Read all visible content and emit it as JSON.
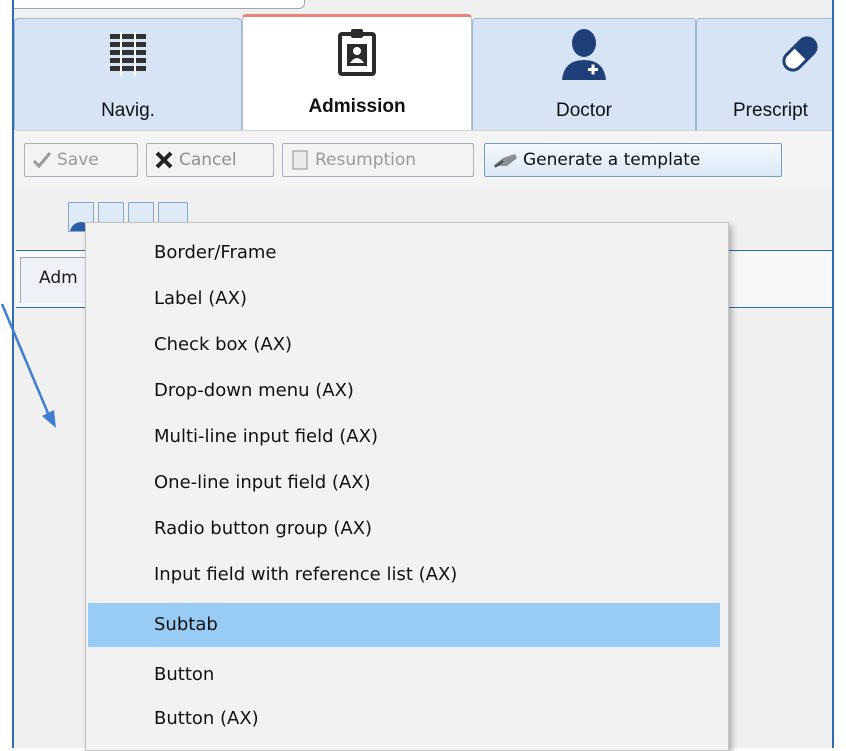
{
  "module_tabs": [
    {
      "label": "Navig.",
      "icon": "list-icon"
    },
    {
      "label": "Admission",
      "icon": "clipboard-id-icon",
      "active": true
    },
    {
      "label": "Doctor",
      "icon": "doctor-icon"
    },
    {
      "label": "Prescript",
      "icon": "pill-icon"
    }
  ],
  "toolbar": {
    "save_label": "Save",
    "cancel_label": "Cancel",
    "resumption_label": "Resumption",
    "generate_label": "Generate a template"
  },
  "content_tab": {
    "label": "Adm"
  },
  "context_menu": {
    "items": [
      "Border/Frame",
      "Label (AX)",
      "Check box (AX)",
      "Drop-down menu (AX)",
      "Multi-line input field (AX)",
      "One-line input field (AX)",
      "Radio button group (AX)",
      "Input field with reference list (AX)",
      "Subtab",
      "Button",
      "Button (AX)"
    ],
    "highlighted": "Subtab"
  },
  "colors": {
    "accent_blue": "#2e6db4",
    "highlight": "#99ccf4",
    "active_tab_top": "#e8827b",
    "arrow": "#3f7dd2"
  }
}
